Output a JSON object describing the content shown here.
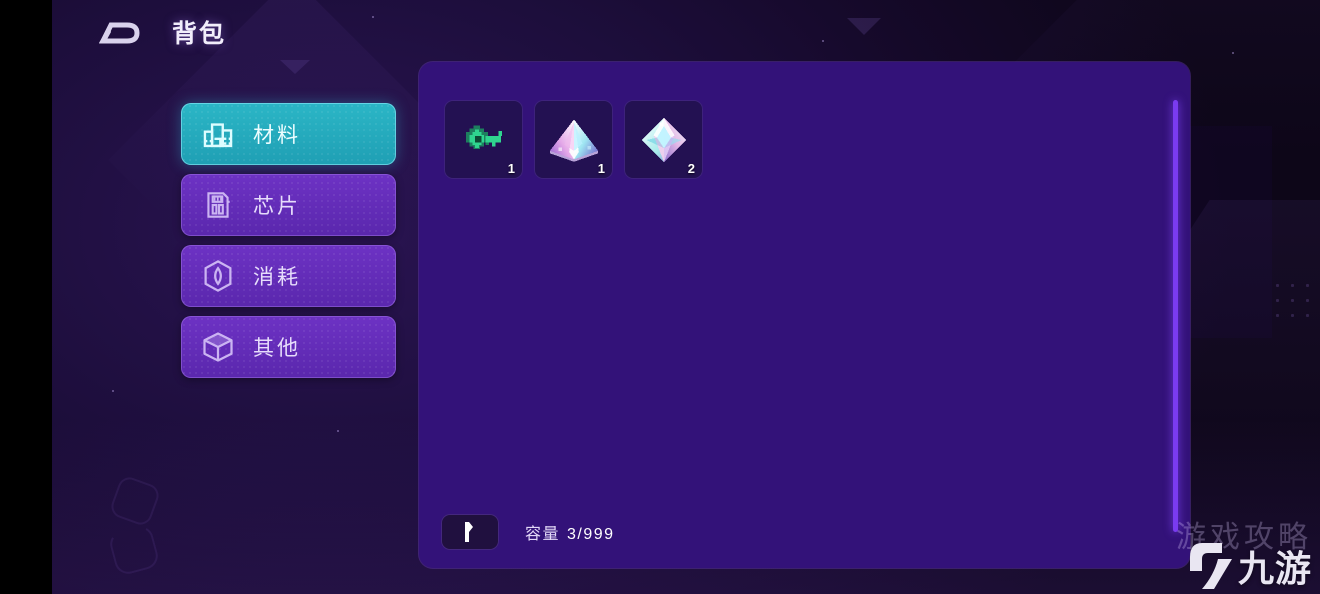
{
  "header": {
    "logo_icon": "game-logo-d-mark",
    "title": "背包"
  },
  "sidebar": {
    "items": [
      {
        "label": "材料",
        "icon": "factory-icon",
        "active": true
      },
      {
        "label": "芯片",
        "icon": "chip-card-icon",
        "active": false
      },
      {
        "label": "消耗",
        "icon": "gem-hex-icon",
        "active": false
      },
      {
        "label": "其他",
        "icon": "cube-icon",
        "active": false
      }
    ]
  },
  "panel": {
    "slots": [
      {
        "item_icon": "green-key-icon",
        "quantity": "1"
      },
      {
        "item_icon": "pyramid-crystal-icon",
        "quantity": "1"
      },
      {
        "item_icon": "diamond-crystal-icon",
        "quantity": "2"
      }
    ],
    "footer": {
      "sort_icon": "sort-flag-icon",
      "capacity_label": "容量",
      "capacity_value": "3/999"
    }
  },
  "watermark": {
    "ghost_text": "游戏攻略",
    "brand_text": "九游",
    "brand_icon": "jiuyou-logo-icon"
  },
  "colors": {
    "panel_bg": "#331279",
    "slot_bg": "#231152",
    "nav_purple": "#6d32c4",
    "nav_active_teal": "#2bb6c6",
    "scrollbar": "#7a3bf0",
    "page_bg": "#1d0e3c"
  }
}
